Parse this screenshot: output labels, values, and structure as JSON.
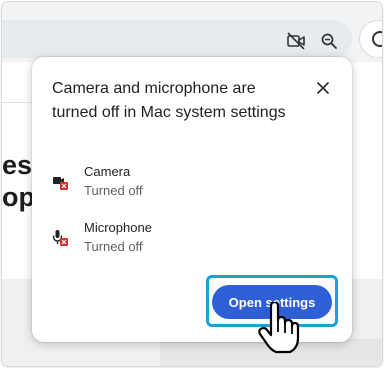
{
  "popup": {
    "title": "Camera and microphone are turned off in Mac system settings",
    "close_icon": "close-icon",
    "permissions": [
      {
        "name": "Camera",
        "status": "Turned off",
        "icon": "camera-blocked-icon"
      },
      {
        "name": "Microphone",
        "status": "Turned off",
        "icon": "microphone-blocked-icon"
      }
    ],
    "open_settings_label": "Open settings"
  },
  "background_page": {
    "headline_fragments": [
      "ess",
      "op"
    ]
  },
  "toolbar": {
    "camera_indicator_icon": "camera-off-icon",
    "zoom_icon": "zoom-icon",
    "profile_icon": "profile-icon"
  },
  "colors": {
    "primary_button": "#2e5fd6",
    "focus_ring": "#1aa1d8",
    "blocked_badge": "#d93025"
  },
  "cursor": "hand-pointer-icon"
}
